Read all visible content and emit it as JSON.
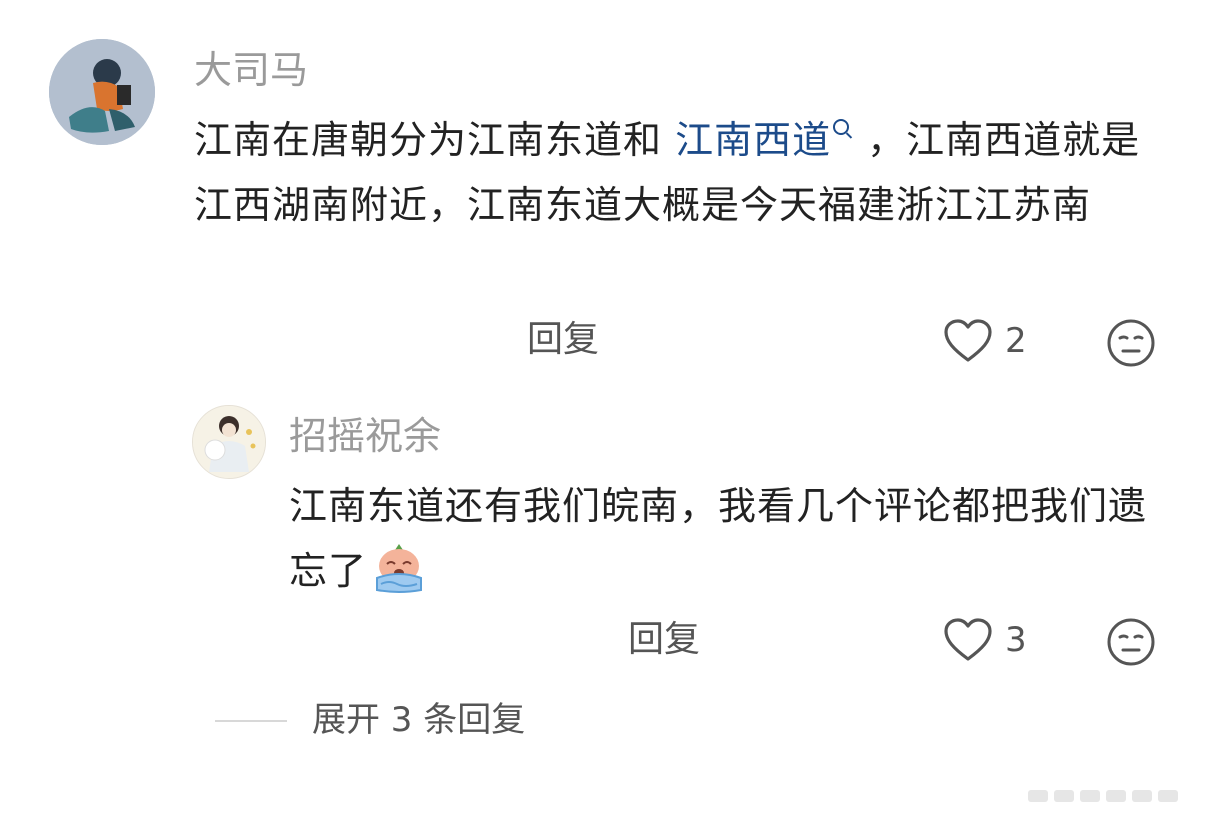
{
  "main_comment": {
    "username": "大司马",
    "text_before_link": "江南在唐朝分为江南东道和 ",
    "link_text": "江南西道",
    "text_after_link": "，江南西道就是江西湖南附近，江南东道大概是今天福建浙江江苏南",
    "reply_label": "回复",
    "like_count": "2",
    "icons": {
      "search_mini": "search-icon",
      "like": "heart-icon",
      "emoji": "emoji-face-icon"
    }
  },
  "reply_comment": {
    "username": "招摇祝余",
    "text": "江南东道还有我们皖南，我看几个评论都把我们遗忘了",
    "inline_emoji": "crying-emoji-icon",
    "reply_label": "回复",
    "like_count": "3",
    "icons": {
      "like": "heart-icon",
      "emoji": "emoji-face-icon"
    }
  },
  "expand": {
    "label": "展开 3 条回复"
  },
  "colors": {
    "link": "#1c4b8a",
    "username": "#9a9a9a",
    "body": "#222222",
    "action": "#555555"
  }
}
